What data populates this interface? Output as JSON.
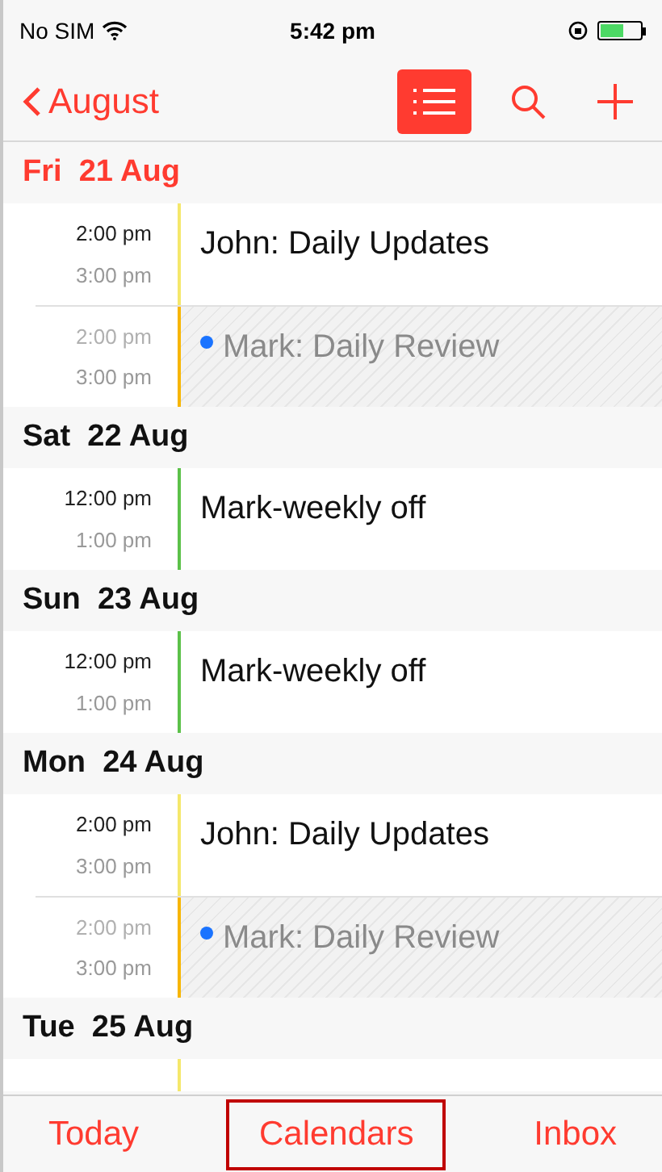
{
  "status_bar": {
    "carrier": "No SIM",
    "time": "5:42 pm",
    "battery": {
      "level": 0.6
    }
  },
  "nav": {
    "back": "August",
    "list_view": {
      "selected": true
    }
  },
  "days": [
    {
      "label": "Fri  21 Aug",
      "today": true,
      "events": [
        {
          "start": "2:00 pm",
          "end": "3:00 pm",
          "title": "John: Daily Updates",
          "color": "#f5e76b",
          "dimmed": false
        },
        {
          "start": "2:00 pm",
          "end": "3:00 pm",
          "title": "Mark: Daily Review",
          "color": "#f7b500",
          "dimmed": true,
          "dot": {
            "color": "#1a73ff"
          }
        }
      ]
    },
    {
      "label": "Sat  22 Aug",
      "today": false,
      "events": [
        {
          "start": "12:00 pm",
          "end": "1:00 pm",
          "title": "Mark-weekly off",
          "color": "#5cc14a",
          "dimmed": false
        }
      ]
    },
    {
      "label": "Sun  23 Aug",
      "today": false,
      "events": [
        {
          "start": "12:00 pm",
          "end": "1:00 pm",
          "title": "Mark-weekly off",
          "color": "#5cc14a",
          "dimmed": false
        }
      ]
    },
    {
      "label": "Mon  24 Aug",
      "today": false,
      "events": [
        {
          "start": "2:00 pm",
          "end": "3:00 pm",
          "title": "John: Daily Updates",
          "color": "#f5e76b",
          "dimmed": false
        },
        {
          "start": "2:00 pm",
          "end": "3:00 pm",
          "title": "Mark: Daily Review",
          "color": "#f7b500",
          "dimmed": true,
          "dot": {
            "color": "#1a73ff"
          }
        }
      ]
    },
    {
      "label": "Tue  25 Aug",
      "today": false,
      "partial_event": {
        "color": "#f5e76b"
      }
    }
  ],
  "tabs": [
    {
      "label": "Today",
      "highlighted": false
    },
    {
      "label": "Calendars",
      "highlighted": true
    },
    {
      "label": "Inbox",
      "highlighted": false
    }
  ]
}
